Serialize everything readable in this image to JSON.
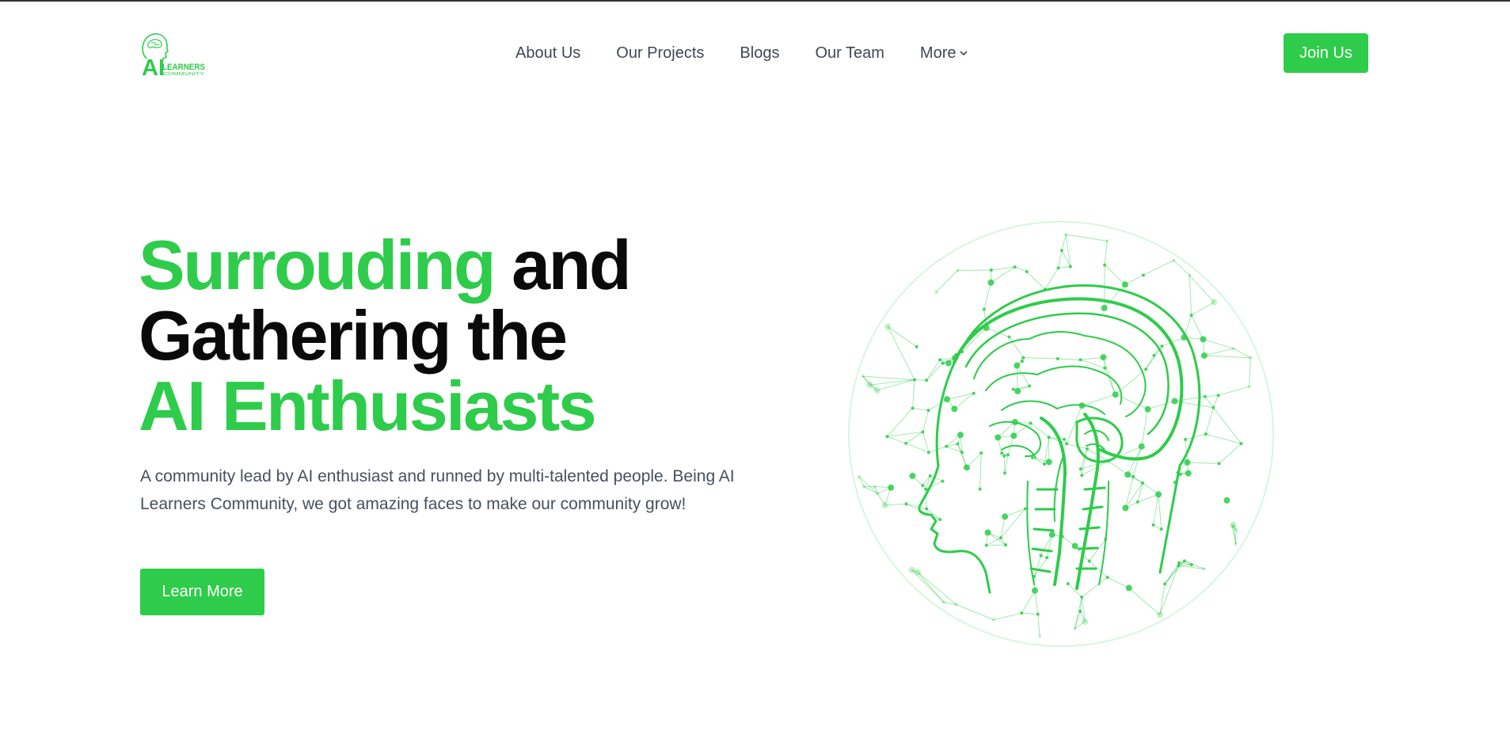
{
  "brand": {
    "logo_main": "AI",
    "logo_word": "LEARNERS",
    "logo_sub": "COMMUNITY",
    "accent_color": "#2ecc4a",
    "logo_icon": "brain-head-icon"
  },
  "nav": {
    "items": [
      {
        "label": "About Us"
      },
      {
        "label": "Our Projects"
      },
      {
        "label": "Blogs"
      },
      {
        "label": "Our Team"
      },
      {
        "label": "More",
        "icon": "chevron-down-icon"
      }
    ],
    "cta_label": "Join Us"
  },
  "hero": {
    "title_line1_green": "Surrouding",
    "title_line1_dark": "and",
    "title_line2": "Gathering the",
    "title_line3": "AI Enthusiasts",
    "description": "A community lead by AI enthusiast and runned by multi-talented people. Being AI Learners Community, we got amazing faces to make our community grow!",
    "button_label": "Learn More",
    "illustration": "brain-network-sphere-illustration"
  }
}
